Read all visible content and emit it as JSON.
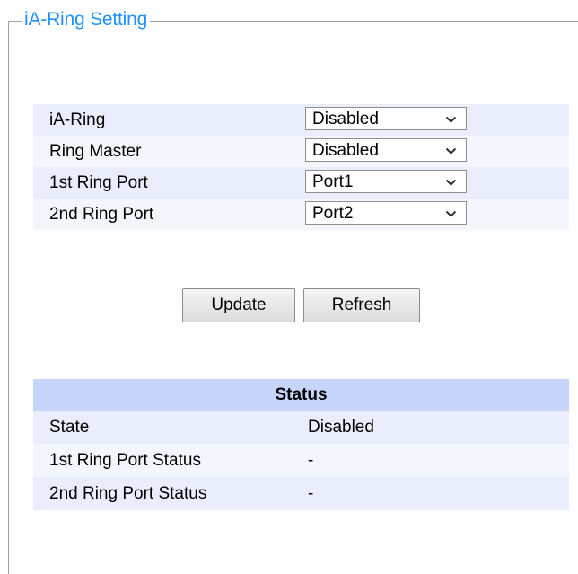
{
  "title": "iA-Ring Setting",
  "settings": [
    {
      "label": "iA-Ring",
      "value": "Disabled"
    },
    {
      "label": "Ring Master",
      "value": "Disabled"
    },
    {
      "label": "1st Ring Port",
      "value": "Port1"
    },
    {
      "label": "2nd Ring Port",
      "value": "Port2"
    }
  ],
  "buttons": {
    "update": "Update",
    "refresh": "Refresh"
  },
  "status": {
    "header": "Status",
    "rows": [
      {
        "key": "State",
        "value": "Disabled"
      },
      {
        "key": "1st Ring Port Status",
        "value": "-"
      },
      {
        "key": "2nd Ring Port Status",
        "value": "-"
      }
    ]
  },
  "icons": {
    "dropdown": "chevron-down-icon"
  },
  "colors": {
    "title": "#1e90ff",
    "row_bg": "#eaeefc",
    "header_bg": "#c7d5fb"
  }
}
